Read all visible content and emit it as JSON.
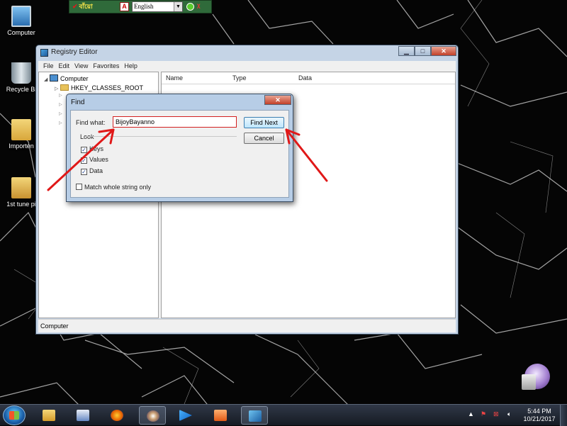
{
  "bijoy_toolbar": {
    "logo_text": "বাঁয়াে",
    "language_value": "English",
    "colors": {
      "bar": "#2f6a3a",
      "logo": "#ffe94a"
    }
  },
  "desktop_icons": [
    {
      "label": "Computer",
      "icon": "computer-icon"
    },
    {
      "label": "Recycle Bi",
      "icon": "recycle-bin-icon"
    },
    {
      "label": "Importen",
      "icon": "folder-icon"
    },
    {
      "label": "1st tune pi",
      "icon": "folder-icon"
    }
  ],
  "registry_editor": {
    "title": "Registry Editor",
    "menu": [
      "File",
      "Edit",
      "View",
      "Favorites",
      "Help"
    ],
    "tree": {
      "root": "Computer",
      "first_key": "HKEY_CLASSES_ROOT"
    },
    "columns": [
      "Name",
      "Type",
      "Data"
    ],
    "status": "Computer"
  },
  "find_dialog": {
    "title": "Find",
    "find_what_label": "Find what:",
    "find_what_value": "BijoyBayanno",
    "find_next_label": "Find Next",
    "cancel_label": "Cancel",
    "look_at_label": "Look",
    "checkboxes": [
      {
        "label": "Keys",
        "checked": true
      },
      {
        "label": "Values",
        "checked": true
      },
      {
        "label": "Data",
        "checked": true
      }
    ],
    "match_whole_label": "Match whole string only",
    "match_whole_checked": false
  },
  "taskbar": {
    "time": "5:44 PM",
    "date": "10/21/2017",
    "apps": [
      "explorer-icon",
      "word-icon",
      "firefox-icon",
      "media-icon",
      "play-icon",
      "video-icon",
      "regedit-icon"
    ]
  },
  "colors": {
    "annotation_arrow": "#e01818",
    "find_field_border": "#d32020",
    "desktop_bg": "#050505"
  }
}
